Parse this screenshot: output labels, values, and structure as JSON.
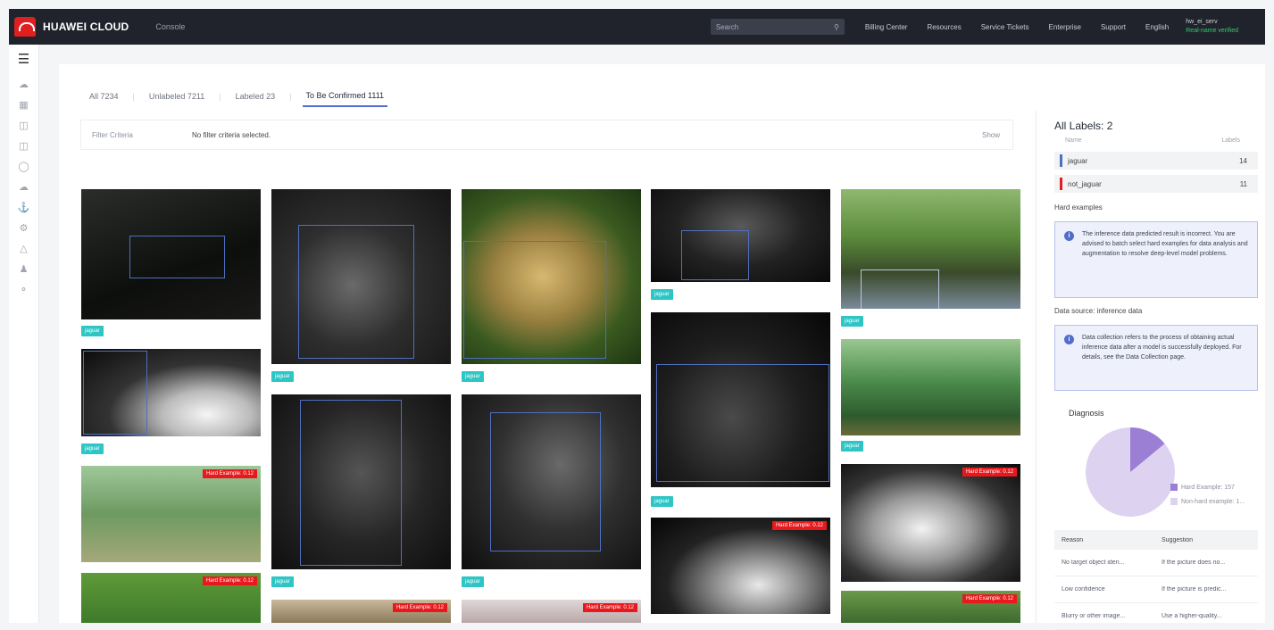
{
  "header": {
    "brand": "HUAWEI CLOUD",
    "console": "Console",
    "search_placeholder": "Search",
    "links": [
      "Billing Center",
      "Resources",
      "Service Tickets",
      "Enterprise",
      "Support",
      "English"
    ],
    "user_name": "hw_ei_serv",
    "user_status": "Real-name verified"
  },
  "tabs": [
    {
      "label": "All 7234",
      "active": false
    },
    {
      "label": "Unlabeled 7211",
      "active": false
    },
    {
      "label": "Labeled 23",
      "active": false
    },
    {
      "label": "To Be Confirmed 1111",
      "active": true
    }
  ],
  "filter": {
    "label": "Filter Criteria",
    "value": "No filter criteria selected.",
    "show": "Show"
  },
  "image_tags": {
    "jaguar": "jaguar",
    "hard": "Hard Example: 0.12"
  },
  "right_panel": {
    "title": "All Labels: 2",
    "col_name": "Name",
    "col_labels": "Labels",
    "labels": [
      {
        "name": "jaguar",
        "count": "14",
        "color": "#4f6fc0"
      },
      {
        "name": "not_jaguar",
        "count": "11",
        "color": "#e02020"
      }
    ],
    "hard_title": "Hard examples",
    "hard_info": "The inference data predicted result is incorrect. You are advised to batch select hard examples for data analysis and augmentation to resolve deep-level model problems.",
    "source_title": "Data source: inference data",
    "source_info": "Data collection refers to the process of obtaining actual inference data after a model is successfully deployed. For details, see the Data Collection page.",
    "diagnosis_title": "Diagnosis",
    "legend": [
      {
        "label": "Hard Example: 157",
        "color": "#9b7fd4"
      },
      {
        "label": "Non-hard example: 1...",
        "color": "#ddd3f0"
      }
    ],
    "table_head": [
      "Reason",
      "Suggestion"
    ],
    "table_rows": [
      [
        "No target object iden...",
        "If the picture does no..."
      ],
      [
        "Low confidence",
        "If the picture is predic..."
      ],
      [
        "Blurry or other image...",
        "Use a higher-quality..."
      ]
    ]
  },
  "diagnosis_chart": {
    "hard_fraction": 0.14
  }
}
